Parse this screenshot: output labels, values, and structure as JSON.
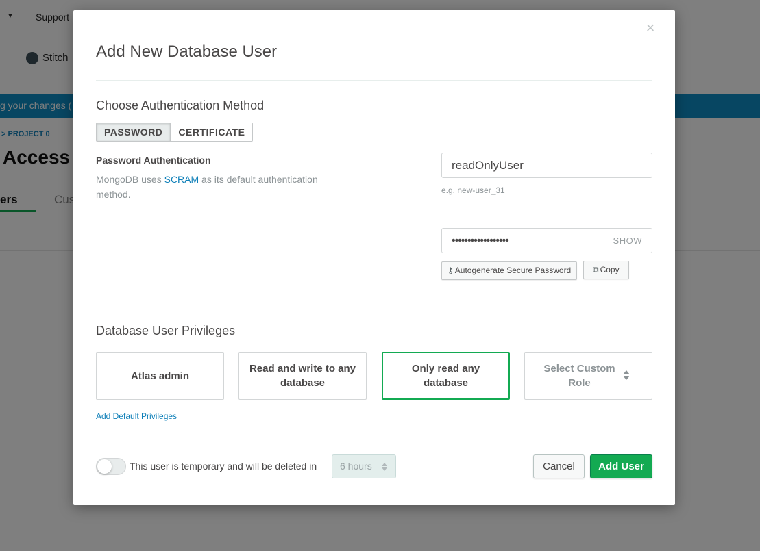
{
  "background": {
    "support_label": "Support",
    "stitch_label": "Stitch",
    "banner_text": "g your changes (",
    "breadcrumb": "> PROJECT 0",
    "page_title": "Access",
    "tab_users": "ers",
    "tab_custom": "Cus"
  },
  "modal": {
    "close_glyph": "×",
    "title": "Add New Database User",
    "auth_section_title": "Choose Authentication Method",
    "auth_methods": [
      {
        "label": "PASSWORD",
        "active": true
      },
      {
        "label": "CERTIFICATE",
        "active": false
      }
    ],
    "password_auth": {
      "heading": "Password Authentication",
      "desc_before": "MongoDB uses ",
      "desc_link": "SCRAM",
      "desc_after": " as its default authentication method."
    },
    "username": {
      "value": "readOnlyUser",
      "hint": "e.g. new-user_31"
    },
    "password": {
      "masked_value": "••••••••••••••••••",
      "show_label": "SHOW"
    },
    "autogenerate_button": "Autogenerate Secure Password",
    "copy_button": "Copy",
    "privileges_section_title": "Database User Privileges",
    "privileges": [
      {
        "label": "Atlas admin",
        "selected": false
      },
      {
        "label": "Read and write to any database",
        "selected": false
      },
      {
        "label": "Only read any database",
        "selected": true
      },
      {
        "label": "Select Custom Role",
        "selected": false
      }
    ],
    "add_default_privileges_link": "Add Default Privileges",
    "temporary_user": {
      "enabled": false,
      "text": "This user is temporary and will be deleted in",
      "duration_value": "6 hours"
    },
    "cancel_button": "Cancel",
    "add_user_button": "Add User"
  },
  "colors": {
    "accent_green": "#13aa52",
    "link_blue": "#0e7fb8",
    "banner_blue": "#0f8cc4"
  }
}
